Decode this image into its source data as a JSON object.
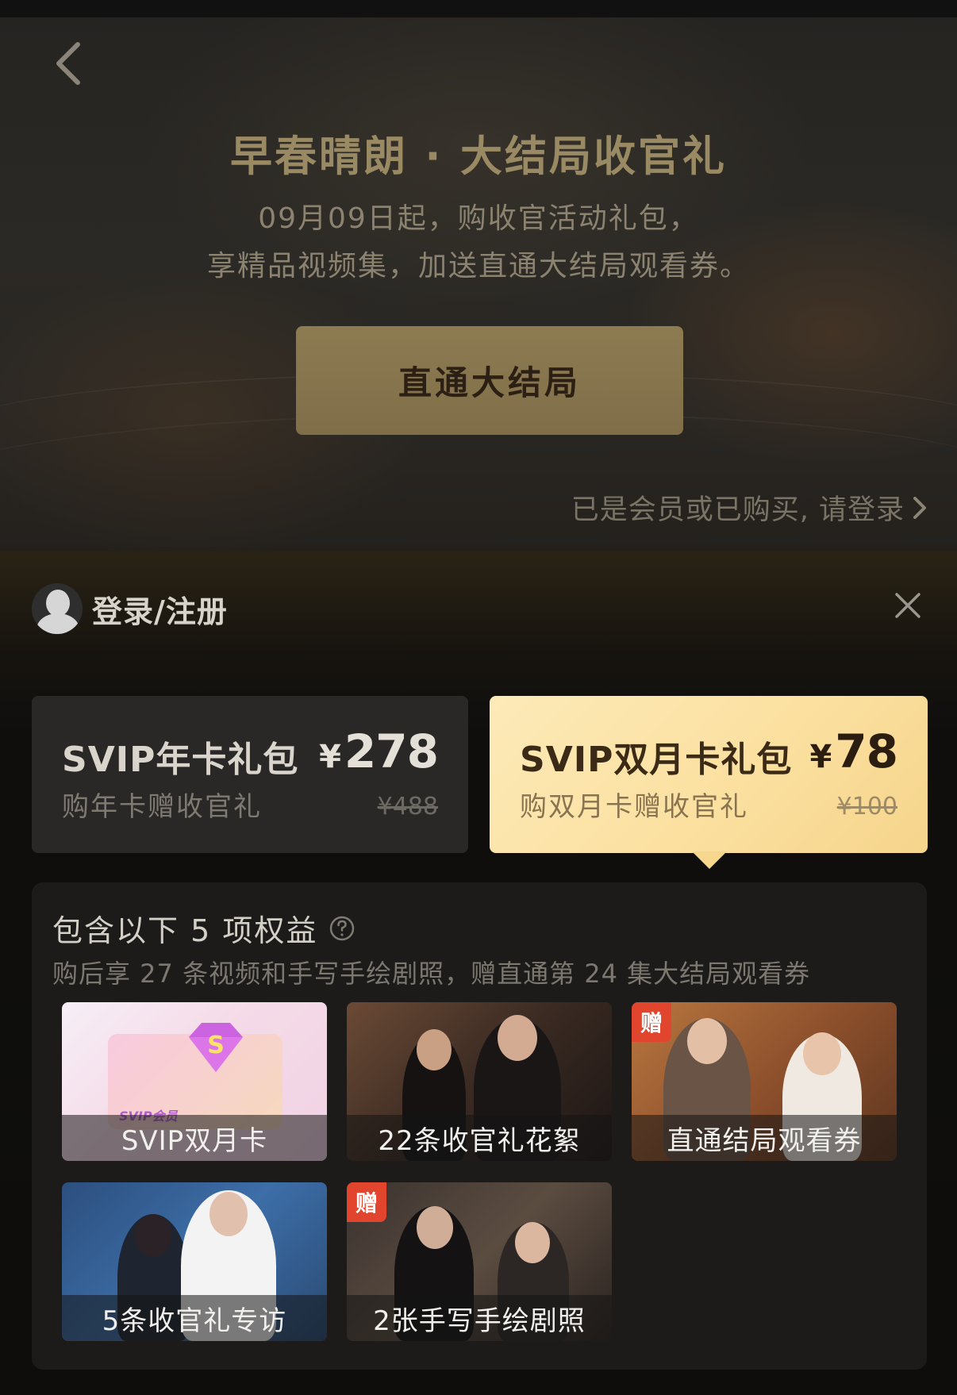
{
  "hero": {
    "title": "早春晴朗 · 大结局收官礼",
    "subtitle_line1": "09月09日起，购收官活动礼包，",
    "subtitle_line2": "享精品视频集，加送直通大结局观看券。",
    "cta_label": "直通大结局",
    "login_prompt": "已是会员或已购买, 请登录"
  },
  "user": {
    "label": "登录/注册"
  },
  "packages": [
    {
      "name": "SVIP年卡礼包",
      "desc": "购年卡赠收官礼",
      "currency": "¥",
      "price": "278",
      "original_price": "¥488",
      "selected": false
    },
    {
      "name": "SVIP双月卡礼包",
      "desc": "购双月卡赠收官礼",
      "currency": "¥",
      "price": "78",
      "original_price": "¥100",
      "selected": true
    }
  ],
  "benefits": {
    "title": "包含以下 5 项权益",
    "subtitle": "购后享 27 条视频和手写手绘剧照，赠直通第 24 集大结局观看券",
    "badge_label": "赠",
    "card_brand_text": "SVIP会员",
    "items": [
      {
        "label": "SVIP双月卡",
        "gift": false
      },
      {
        "label": "22条收官礼花絮",
        "gift": false
      },
      {
        "label": "直通结局观看券",
        "gift": true
      },
      {
        "label": "5条收官礼专访",
        "gift": false
      },
      {
        "label": "2张手写手绘剧照",
        "gift": true
      }
    ]
  },
  "colors": {
    "accent_gold": "#f7d68e",
    "gift_badge": "#e2452d",
    "hero_title": "#9a8a63"
  },
  "icons": {
    "back": "chevron-left-icon",
    "close": "close-icon",
    "help": "question-circle-icon",
    "login_arrow": "chevron-right-icon"
  }
}
